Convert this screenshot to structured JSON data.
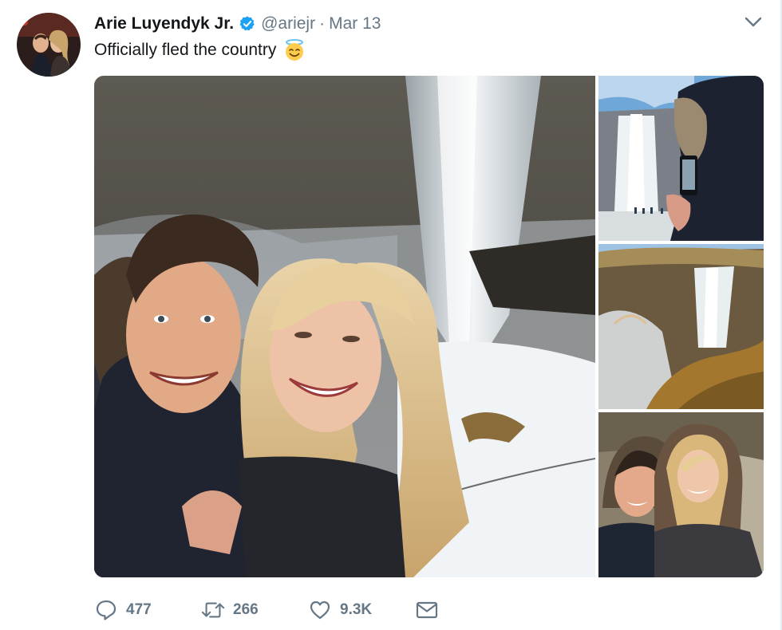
{
  "author": {
    "display_name": "Arie Luyendyk Jr.",
    "handle": "@ariejr",
    "separator": "·",
    "date": "Mar 13",
    "verified": true
  },
  "tweet": {
    "text": "Officially fled the country",
    "emoji": "smiling-face-with-halo"
  },
  "media": {
    "count": 4
  },
  "actions": {
    "replies": "477",
    "retweets": "266",
    "likes": "9.3K"
  },
  "colors": {
    "text": "#14171a",
    "secondary": "#657786",
    "verified": "#1da1f2",
    "border": "#e6ecf0"
  },
  "icons": [
    "verified-badge-icon",
    "chevron-down-icon",
    "reply-icon",
    "retweet-icon",
    "like-icon",
    "direct-message-icon"
  ]
}
